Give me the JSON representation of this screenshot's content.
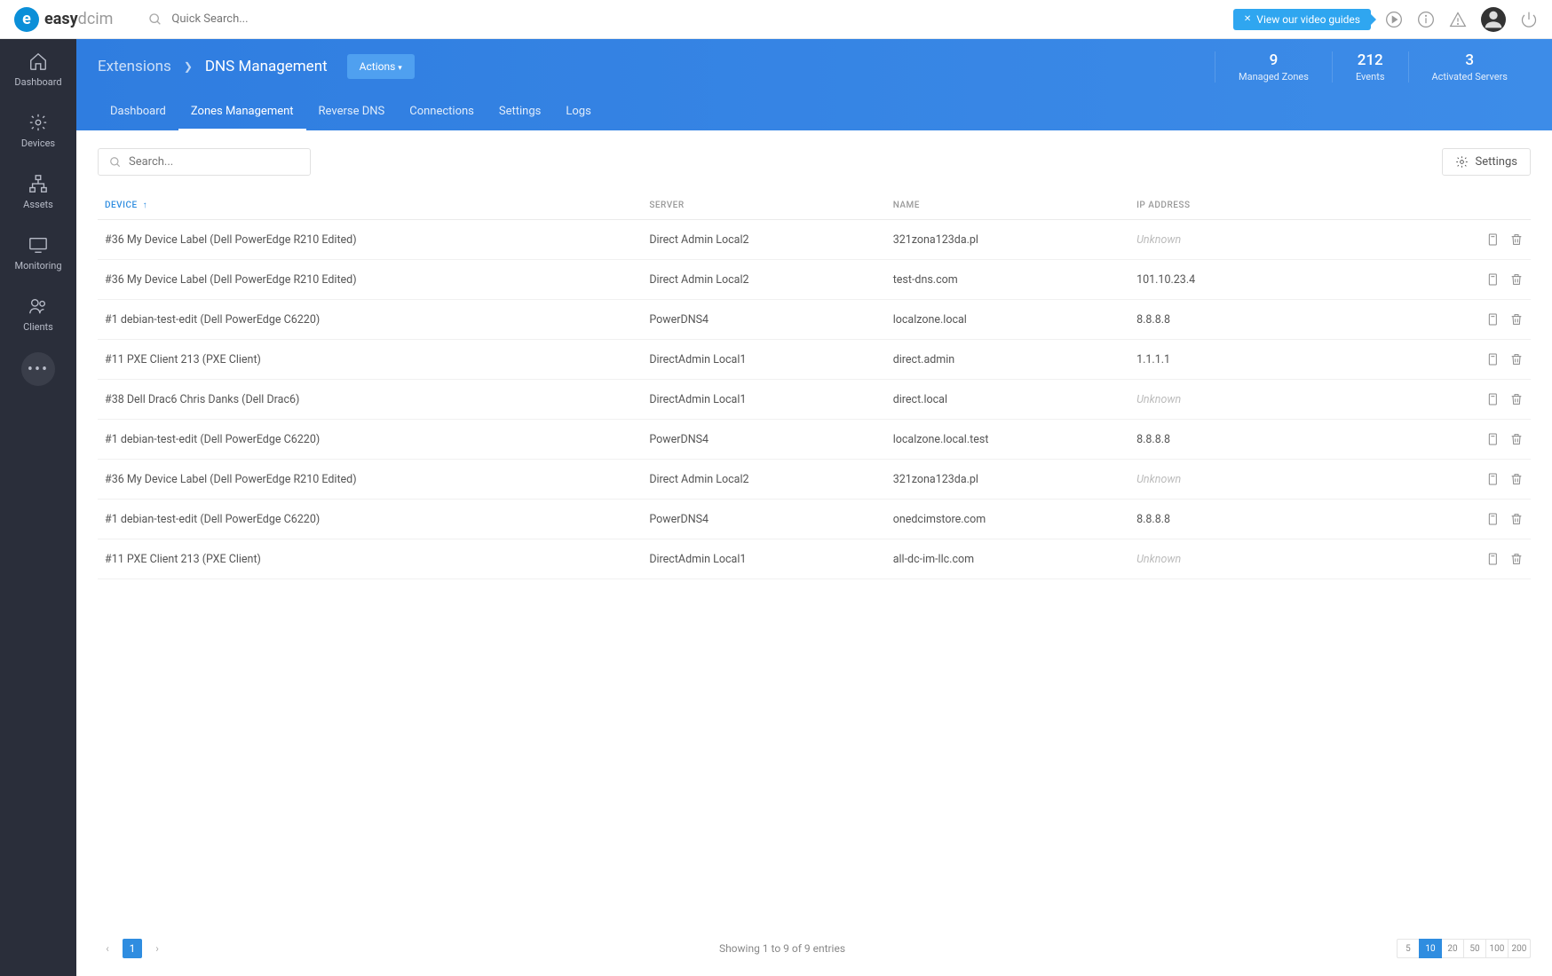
{
  "logo": {
    "bold": "easy",
    "light": "dcim"
  },
  "search_placeholder": "Quick Search...",
  "video_guides": "View our video guides",
  "sidebar": [
    {
      "label": "Dashboard",
      "icon": "home"
    },
    {
      "label": "Devices",
      "icon": "gear"
    },
    {
      "label": "Assets",
      "icon": "sitemap"
    },
    {
      "label": "Monitoring",
      "icon": "monitor"
    },
    {
      "label": "Clients",
      "icon": "users"
    }
  ],
  "breadcrumb": {
    "parent": "Extensions",
    "current": "DNS Management"
  },
  "actions_label": "Actions",
  "stats": [
    {
      "num": "9",
      "label": "Managed Zones"
    },
    {
      "num": "212",
      "label": "Events"
    },
    {
      "num": "3",
      "label": "Activated Servers"
    }
  ],
  "tabs": [
    "Dashboard",
    "Zones Management",
    "Reverse DNS",
    "Connections",
    "Settings",
    "Logs"
  ],
  "active_tab": 1,
  "table_search_placeholder": "Search...",
  "settings_btn": "Settings",
  "columns": [
    "DEVICE",
    "SERVER",
    "NAME",
    "IP ADDRESS",
    ""
  ],
  "sorted_col": 0,
  "rows": [
    {
      "device": "#36 My Device Label (Dell PowerEdge R210 Edited)",
      "server": "Direct Admin Local2",
      "name": "321zona123da.pl",
      "ip": "Unknown"
    },
    {
      "device": "#36 My Device Label (Dell PowerEdge R210 Edited)",
      "server": "Direct Admin Local2",
      "name": "test-dns.com",
      "ip": "101.10.23.4"
    },
    {
      "device": "#1 debian-test-edit (Dell PowerEdge C6220)",
      "server": "PowerDNS4",
      "name": "localzone.local",
      "ip": "8.8.8.8"
    },
    {
      "device": "#11 PXE Client 213 (PXE Client)",
      "server": "DirectAdmin Local1",
      "name": "direct.admin",
      "ip": "1.1.1.1"
    },
    {
      "device": "#38 Dell Drac6 Chris Danks (Dell Drac6)",
      "server": "DirectAdmin Local1",
      "name": "direct.local",
      "ip": "Unknown"
    },
    {
      "device": "#1 debian-test-edit (Dell PowerEdge C6220)",
      "server": "PowerDNS4",
      "name": "localzone.local.test",
      "ip": "8.8.8.8"
    },
    {
      "device": "#36 My Device Label (Dell PowerEdge R210 Edited)",
      "server": "Direct Admin Local2",
      "name": "321zona123da.pl",
      "ip": "Unknown"
    },
    {
      "device": "#1 debian-test-edit (Dell PowerEdge C6220)",
      "server": "PowerDNS4",
      "name": "onedcimstore.com",
      "ip": "8.8.8.8"
    },
    {
      "device": "#11 PXE Client 213 (PXE Client)",
      "server": "DirectAdmin Local1",
      "name": "all-dc-im-llc.com",
      "ip": "Unknown"
    }
  ],
  "showing_text": "Showing 1 to 9 of 9 entries",
  "current_page": "1",
  "page_sizes": [
    "5",
    "10",
    "20",
    "50",
    "100",
    "200"
  ],
  "active_size": 1
}
